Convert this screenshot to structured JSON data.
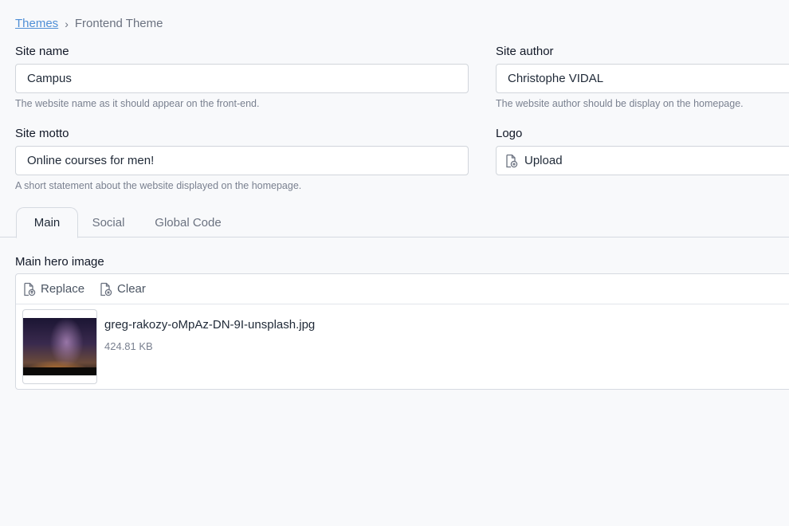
{
  "breadcrumb": {
    "parent": "Themes",
    "separator": "›",
    "current": "Frontend Theme"
  },
  "form": {
    "site_name": {
      "label": "Site name",
      "value": "Campus",
      "hint": "The website name as it should appear on the front-end."
    },
    "site_author": {
      "label": "Site author",
      "value": "Christophe VIDAL",
      "hint": "The website author should be display on the homepage."
    },
    "site_motto": {
      "label": "Site motto",
      "value": "Online courses for men!",
      "hint": "A short statement about the website displayed on the homepage."
    },
    "logo": {
      "label": "Logo",
      "button": "Upload",
      "icon": "file-upload-icon"
    }
  },
  "tabs": [
    {
      "label": "Main",
      "active": true
    },
    {
      "label": "Social",
      "active": false
    },
    {
      "label": "Global Code",
      "active": false
    }
  ],
  "hero": {
    "label": "Main hero image",
    "replace_label": "Replace",
    "clear_label": "Clear",
    "file_name": "greg-rakozy-oMpAz-DN-9I-unsplash.jpg",
    "file_size": "424.81 KB"
  },
  "colors": {
    "link": "#4f8fd6",
    "border": "#d6dae1",
    "background": "#f8f9fb"
  }
}
